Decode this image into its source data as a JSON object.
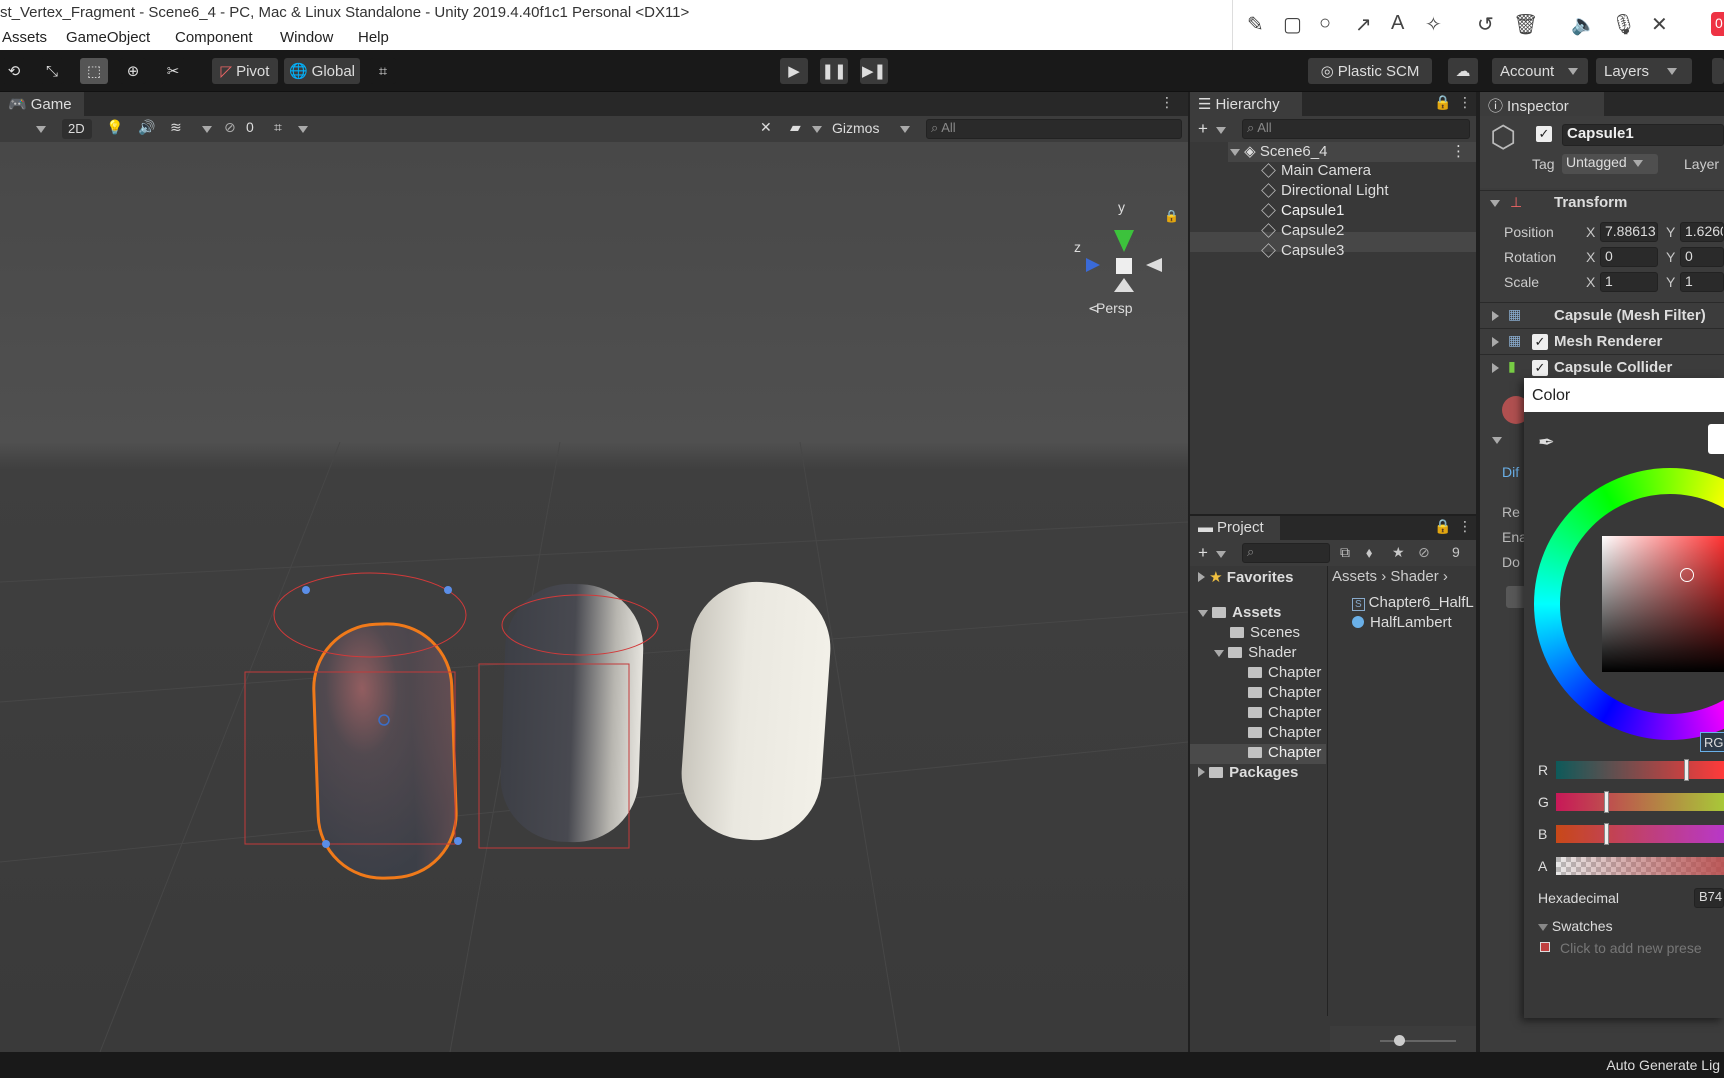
{
  "window": {
    "title": "st_Vertex_Fragment - Scene6_4 - PC, Mac & Linux Standalone - Unity 2019.4.40f1c1 Personal <DX11>"
  },
  "menu": [
    "Assets",
    "GameObject",
    "Component",
    "Window",
    "Help"
  ],
  "annotation_tools": [
    "pencil-icon",
    "rectangle-icon",
    "circle-icon",
    "arrow-icon",
    "text-icon",
    "magic-icon",
    "undo-icon",
    "trash-icon",
    "speaker-icon",
    "mic-icon",
    "close-icon"
  ],
  "annotation_badge": "0",
  "toolbar": {
    "pivot": "Pivot",
    "global": "Global",
    "plastic": "Plastic SCM",
    "account": "Account",
    "layers": "Layers"
  },
  "scene_view": {
    "tab": "Game",
    "mode_2d": "2D",
    "hidden_count": "0",
    "gizmos": "Gizmos",
    "search_placeholder": "All",
    "persp": "Persp",
    "axis_y": "y",
    "axis_z": "z"
  },
  "hierarchy": {
    "tab": "Hierarchy",
    "search_placeholder": "All",
    "scene": "Scene6_4",
    "items": [
      "Main Camera",
      "Directional Light",
      "Capsule1",
      "Capsule2",
      "Capsule3"
    ],
    "selected": "Capsule1"
  },
  "project": {
    "tab": "Project",
    "hidden_count": "9",
    "favorites": "Favorites",
    "assets": "Assets",
    "scenes": "Scenes",
    "shader": "Shader",
    "chapters": [
      "Chapter",
      "Chapter",
      "Chapter",
      "Chapter",
      "Chapter"
    ],
    "packages": "Packages",
    "breadcrumb": [
      "Assets",
      "Shader"
    ],
    "files": [
      "Chapter6_HalfL",
      "HalfLambert"
    ]
  },
  "inspector": {
    "tab": "Inspector",
    "object_name": "Capsule1",
    "tag_label": "Tag",
    "tag_value": "Untagged",
    "layer_label": "Layer",
    "transform": "Transform",
    "position_label": "Position",
    "rotation_label": "Rotation",
    "scale_label": "Scale",
    "position": {
      "x": "7.88613",
      "y": "1.6260"
    },
    "rotation": {
      "x": "0",
      "y": "0"
    },
    "scale": {
      "x": "1",
      "y": "1"
    },
    "components": [
      "Capsule (Mesh Filter)",
      "Mesh Renderer",
      "Capsule Collider"
    ],
    "partial_labels": [
      "Dif",
      "Re",
      "Ena",
      "Do"
    ]
  },
  "color_picker": {
    "title": "Color",
    "mode": "RG",
    "channels": [
      "R",
      "G",
      "B",
      "A"
    ],
    "hex_label": "Hexadecimal",
    "hex_value": "B74",
    "swatches": "Swatches",
    "add_preset": "Click to add new prese"
  },
  "status": {
    "right": "Auto Generate Lig"
  }
}
